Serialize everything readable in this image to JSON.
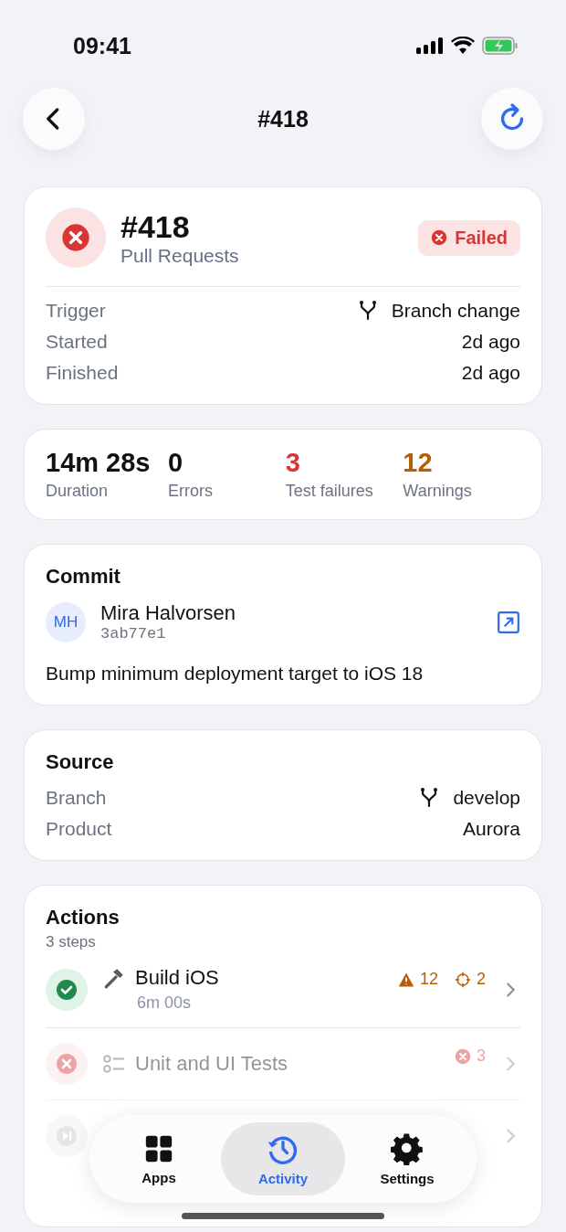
{
  "status_bar": {
    "time": "09:41"
  },
  "nav": {
    "title": "#418"
  },
  "build": {
    "number": "#418",
    "workflow": "Pull Requests",
    "kind": "failed",
    "status_label": "Failed",
    "details": [
      {
        "label": "Trigger",
        "value": "Branch change",
        "kind": "branch"
      },
      {
        "label": "Started",
        "value": "2d ago",
        "kind": "plain"
      },
      {
        "label": "Finished",
        "value": "2d ago",
        "kind": "plain"
      }
    ]
  },
  "metrics": [
    {
      "value": "14m 28s",
      "label": "Duration",
      "kind": "neutral"
    },
    {
      "value": "0",
      "label": "Errors",
      "kind": "neutral"
    },
    {
      "value": "3",
      "label": "Test failures",
      "kind": "error"
    },
    {
      "value": "12",
      "label": "Warnings",
      "kind": "warning"
    }
  ],
  "commit": {
    "title": "Commit",
    "initials": "MH",
    "author": "Mira Halvorsen",
    "hash": "3ab77e1",
    "message": "Bump minimum deployment target to iOS 18"
  },
  "source": {
    "title": "Source",
    "rows": [
      {
        "label": "Branch",
        "value": "develop",
        "kind": "branch"
      },
      {
        "label": "Product",
        "value": "Aurora",
        "kind": "plain"
      }
    ]
  },
  "actions": {
    "title": "Actions",
    "subtitle": "3 steps",
    "steps": [
      {
        "kind": "success",
        "title": "Build iOS",
        "duration": "6m 00s",
        "badges": [
          {
            "kind": "warning",
            "count": "12"
          },
          {
            "kind": "issue",
            "count": "2"
          }
        ]
      },
      {
        "kind": "failed",
        "title": "Unit and UI Tests",
        "badges": [
          {
            "kind": "error",
            "count": "3"
          }
        ]
      },
      {
        "kind": "skipped"
      }
    ]
  },
  "tab_bar": [
    {
      "label": "Apps",
      "selected": false
    },
    {
      "label": "Activity",
      "selected": true
    },
    {
      "label": "Settings",
      "selected": false
    }
  ]
}
